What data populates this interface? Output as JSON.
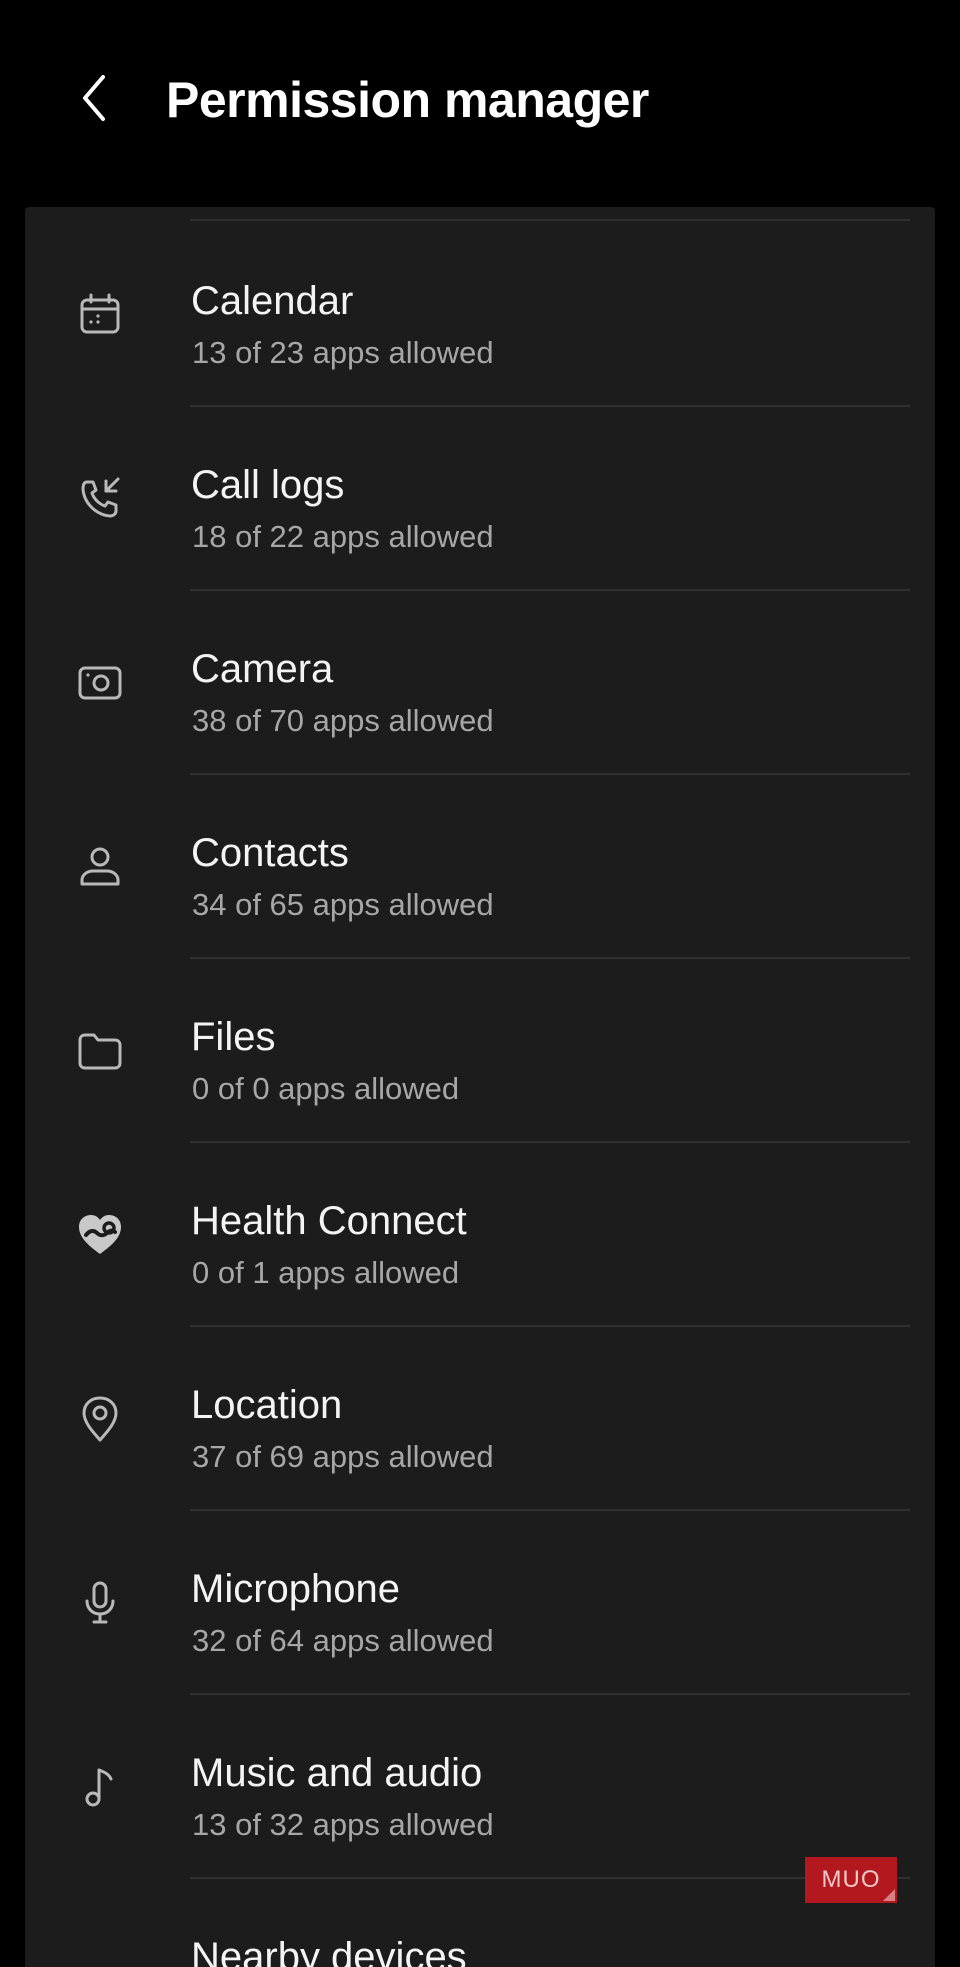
{
  "header": {
    "title": "Permission manager",
    "back_icon": "chevron-left-icon"
  },
  "permissions": [
    {
      "label": "Calendar",
      "status": "13 of 23 apps allowed",
      "icon": "calendar-icon"
    },
    {
      "label": "Call logs",
      "status": "18 of 22 apps allowed",
      "icon": "call-log-icon"
    },
    {
      "label": "Camera",
      "status": "38 of 70 apps allowed",
      "icon": "camera-icon"
    },
    {
      "label": "Contacts",
      "status": "34 of 65 apps allowed",
      "icon": "contact-person-icon"
    },
    {
      "label": "Files",
      "status": "0 of 0 apps allowed",
      "icon": "folder-icon"
    },
    {
      "label": "Health Connect",
      "status": "0 of 1 apps allowed",
      "icon": "health-connect-icon"
    },
    {
      "label": "Location",
      "status": "37 of 69 apps allowed",
      "icon": "location-pin-icon"
    },
    {
      "label": "Microphone",
      "status": "32 of 64 apps allowed",
      "icon": "microphone-icon"
    },
    {
      "label": "Music and audio",
      "status": "13 of 32 apps allowed",
      "icon": "music-note-icon"
    },
    {
      "label": "Nearby devices",
      "status": "",
      "icon": "nearby-devices-icon"
    }
  ],
  "watermark": {
    "text": "MUO",
    "color": "#b3181f"
  },
  "colors": {
    "background": "#000000",
    "card": "#1c1c1d",
    "title_text": "#f4f4f4",
    "subtitle_text": "#a7a7a8",
    "icon": "#b9b9ba",
    "divider": "#2f2f30"
  }
}
